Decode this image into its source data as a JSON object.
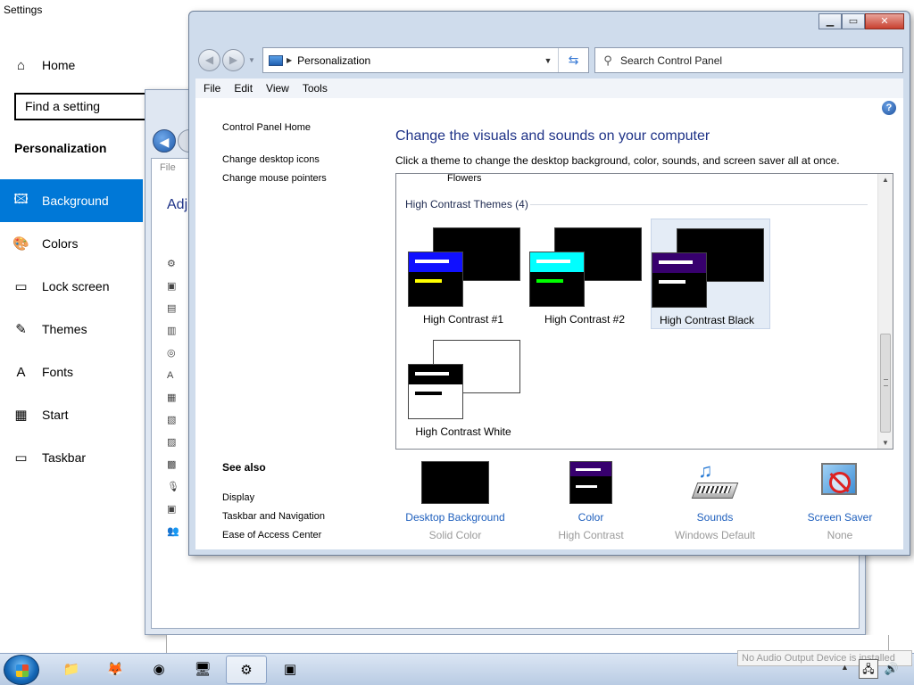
{
  "settings": {
    "title": "Settings",
    "home": "Home",
    "search_placeholder": "Find a setting",
    "section": "Personalization",
    "items": [
      {
        "label": "Background",
        "icon": "image-icon",
        "glyph": "🖾"
      },
      {
        "label": "Colors",
        "icon": "palette-icon",
        "glyph": "🎨"
      },
      {
        "label": "Lock screen",
        "icon": "lock-screen-icon",
        "glyph": "▭"
      },
      {
        "label": "Themes",
        "icon": "themes-icon",
        "glyph": "✎"
      },
      {
        "label": "Fonts",
        "icon": "fonts-icon",
        "glyph": "A"
      },
      {
        "label": "Start",
        "icon": "start-icon",
        "glyph": "▦"
      },
      {
        "label": "Taskbar",
        "icon": "taskbar-icon",
        "glyph": "▭"
      }
    ],
    "active_index": 0
  },
  "mid_window": {
    "file_menu": "File",
    "heading_partial": "Adj"
  },
  "window": {
    "nav": {
      "address": "Personalization",
      "search_placeholder": "Search Control Panel"
    },
    "menu": [
      "File",
      "Edit",
      "View",
      "Tools"
    ],
    "left_links": [
      "Control Panel Home",
      "Change desktop icons",
      "Change mouse pointers"
    ],
    "see_also": {
      "title": "See also",
      "links": [
        "Display",
        "Taskbar and Navigation",
        "Ease of Access Center"
      ]
    },
    "heading": "Change the visuals and sounds on your computer",
    "subtext": "Click a theme to change the desktop background, color, sounds, and screen saver all at once.",
    "theme_list": {
      "partial_label": "Flowers",
      "group_label": "High Contrast Themes (4)",
      "themes": [
        {
          "label": "High Contrast #1",
          "front_bg": "#000000",
          "bar": "#1010ff",
          "line1": "#ffffff",
          "line2": "#ffff00",
          "back_bg": "#000000",
          "selected": false
        },
        {
          "label": "High Contrast #2",
          "front_bg": "#000000",
          "bar": "#00ffff",
          "line1": "#ffffff",
          "line2": "#00ff00",
          "back_bg": "#000000",
          "selected": false
        },
        {
          "label": "High Contrast Black",
          "front_bg": "#000000",
          "bar": "#37006e",
          "line1": "#ffffff",
          "line2": "#ffffff",
          "back_bg": "#000000",
          "selected": true
        },
        {
          "label": "High Contrast White",
          "front_bg": "#ffffff",
          "bar": "#000000",
          "line1": "#ffffff",
          "line2": "#000000",
          "back_bg": "#ffffff",
          "selected": false
        }
      ]
    },
    "bottom_items": [
      {
        "name": "Desktop Background",
        "value": "Solid Color",
        "icon": "desktop-background-icon"
      },
      {
        "name": "Color",
        "value": "High Contrast",
        "icon": "color-icon"
      },
      {
        "name": "Sounds",
        "value": "Windows Default",
        "icon": "sounds-icon"
      },
      {
        "name": "Screen Saver",
        "value": "None",
        "icon": "screen-saver-icon"
      }
    ]
  },
  "taskbar": {
    "notification": "No Audio Output Device is installed",
    "apps": [
      {
        "icon": "file-explorer-icon",
        "glyph": "📁"
      },
      {
        "icon": "firefox-icon",
        "glyph": "🦊"
      },
      {
        "icon": "chrome-icon",
        "glyph": "◉"
      },
      {
        "icon": "network-app-icon",
        "glyph": "🖥"
      },
      {
        "icon": "settings-gear-icon",
        "glyph": "⚙"
      },
      {
        "icon": "control-panel-icon",
        "glyph": "▣"
      }
    ]
  }
}
